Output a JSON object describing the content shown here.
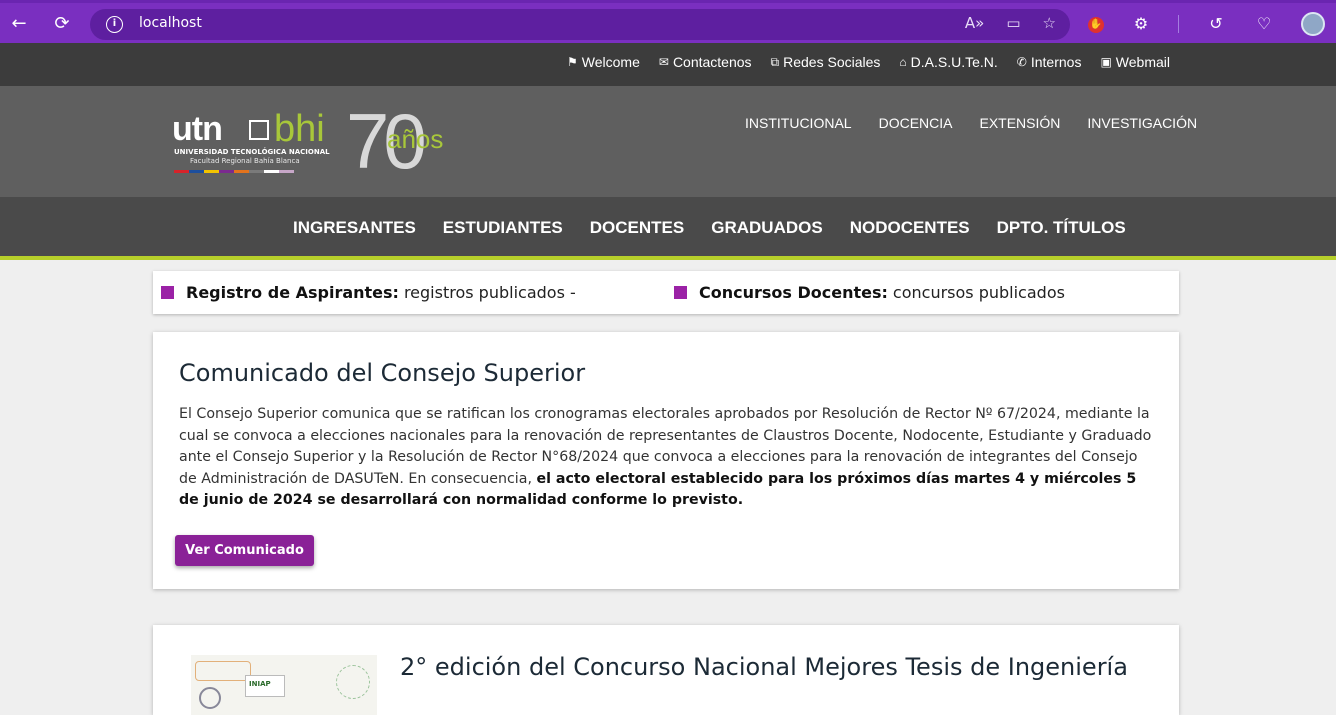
{
  "browser": {
    "url": "localhost",
    "back_icon": "arrow-left-icon",
    "reload_icon": "reload-icon"
  },
  "utility_links": [
    {
      "label": "Welcome",
      "icon": "flag-icon",
      "glyph": "⚑"
    },
    {
      "label": "Contactenos",
      "icon": "envelope-icon",
      "glyph": "✉"
    },
    {
      "label": "Redes Sociales",
      "icon": "network-icon",
      "glyph": "⧉"
    },
    {
      "label": "D.A.S.U.Te.N.",
      "icon": "home-icon",
      "glyph": "⌂"
    },
    {
      "label": "Internos",
      "icon": "phone-icon",
      "glyph": "✆"
    },
    {
      "label": "Webmail",
      "icon": "inbox-icon",
      "glyph": "▣"
    }
  ],
  "logo": {
    "utn": "utn",
    "bhi": "bhi",
    "line1": "UNIVERSIDAD TECNOLÓGICA NACIONAL",
    "line2": "Facultad Regional Bahía Blanca",
    "seventy": "70",
    "anos": "años",
    "stripe_colors": [
      "#d6232a",
      "#1d4f9e",
      "#f2c300",
      "#7b2a8f",
      "#e3731d",
      "#7a7a7a",
      "#ffffff",
      "#c7a7c8"
    ]
  },
  "main_nav": [
    "INSTITUCIONAL",
    "DOCENCIA",
    "EXTENSIÓN",
    "INVESTIGACIÓN"
  ],
  "secondary_nav": [
    "INGRESANTES",
    "ESTUDIANTES",
    "DOCENTES",
    "GRADUADOS",
    "NODOCENTES",
    "DPTO. TÍTULOS"
  ],
  "ticker": [
    {
      "bold": "Registro de Aspirantes:",
      "text": "registros publicados -"
    },
    {
      "bold": "Concursos Docentes:",
      "text": "concursos publicados"
    }
  ],
  "card1": {
    "title": "Comunicado del Consejo Superior",
    "body_plain": "El Consejo Superior comunica que se ratifican los cronogramas electorales aprobados por Resolución de Rector Nº 67/2024, mediante la cual se convoca a elecciones nacionales para la renovación de representantes de Claustros Docente, Nodocente, Estudiante y Graduado ante el Consejo Superior y la Resolución de Rector N°68/2024 que convoca a elecciones para la renovación de integrantes del Consejo de Administración de DASUTeN. En consecuencia,",
    "body_bold": "el acto electoral establecido para los próximos días martes 4 y miércoles 5 de junio de 2024 se desarrollará con normalidad conforme lo previsto.",
    "button": "Ver Comunicado"
  },
  "card2": {
    "title": "2° edición del Concurso Nacional Mejores Tesis de Ingeniería",
    "thumb_label": "INIAP"
  },
  "colors": {
    "accent_purple": "#8a2197",
    "accent_green": "#b6cf2a",
    "browser_purple": "#7a2fc0"
  }
}
